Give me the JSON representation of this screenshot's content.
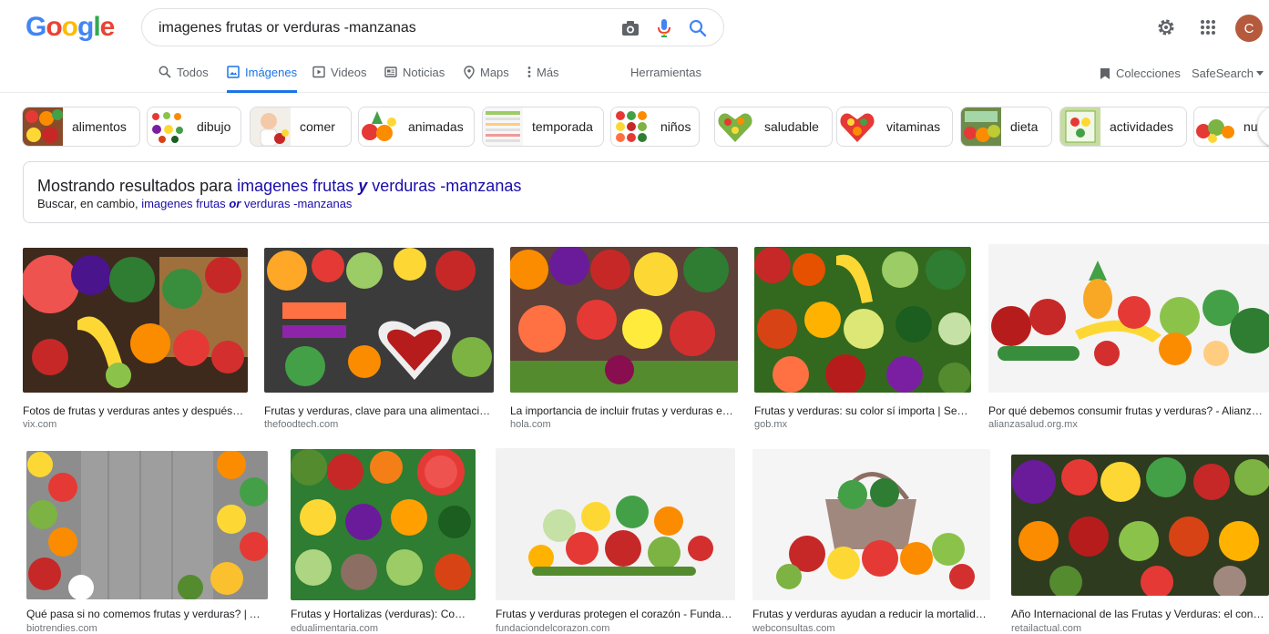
{
  "logo": {
    "g1": "G",
    "o1": "o",
    "o2": "o",
    "g2": "g",
    "l": "l",
    "e": "e"
  },
  "search": {
    "query": "imagenes frutas or verduras -manzanas"
  },
  "account": {
    "initial": "C"
  },
  "tabs": [
    {
      "label": "Todos",
      "icon": "search-icon"
    },
    {
      "label": "Imágenes",
      "icon": "image-icon"
    },
    {
      "label": "Videos",
      "icon": "video-icon"
    },
    {
      "label": "Noticias",
      "icon": "news-icon"
    },
    {
      "label": "Maps",
      "icon": "map-pin-icon"
    },
    {
      "label": "Más",
      "icon": "more-vert-icon"
    }
  ],
  "tools_label": "Herramientas",
  "collections_label": "Colecciones",
  "safesearch_label": "SafeSearch",
  "chips": [
    {
      "label": "alimentos"
    },
    {
      "label": "dibujo"
    },
    {
      "label": "comer"
    },
    {
      "label": "animadas"
    },
    {
      "label": "temporada"
    },
    {
      "label": "niños"
    },
    {
      "label": "saludable"
    },
    {
      "label": "vitaminas"
    },
    {
      "label": "dieta"
    },
    {
      "label": "actividades"
    },
    {
      "label": "nut"
    }
  ],
  "correction": {
    "showing_prefix": "Mostrando resultados para",
    "corrected_a": "imagenes frutas",
    "corrected_b": "y",
    "corrected_c": "verduras -manzanas",
    "instead_prefix": "Buscar, en cambio,",
    "original_a": "imagenes frutas",
    "original_b": "or",
    "original_c": "verduras -manzanas"
  },
  "results": [
    {
      "caption": "Fotos de frutas y verduras antes y después d...",
      "source": "vix.com"
    },
    {
      "caption": "Frutas y verduras, clave para una alimentación...",
      "source": "thefoodtech.com"
    },
    {
      "caption": "La importancia de incluir frutas y verduras en ...",
      "source": "hola.com"
    },
    {
      "caption": "Frutas y verduras: su color sí importa | Secr...",
      "source": "gob.mx"
    },
    {
      "caption": "Por qué debemos consumir frutas y verduras? - Alianza po...",
      "source": "alianzasalud.org.mx"
    },
    {
      "caption": "Qué pasa si no comemos frutas y verduras? | Aus...",
      "source": "biotrendies.com"
    },
    {
      "caption": "Frutas y Hortalizas (verduras): Compo...",
      "source": "edualimentaria.com"
    },
    {
      "caption": "Frutas y verduras protegen el corazón - Fundació...",
      "source": "fundaciondelcorazon.com"
    },
    {
      "caption": "Frutas y verduras ayudan a reducir la mortalidad...",
      "source": "webconsultas.com"
    },
    {
      "caption": "Año Internacional de las Frutas y Verduras: el consum...",
      "source": "retailactual.com"
    }
  ],
  "colors": {
    "link": "#1a0dab",
    "accent": "#1a73e8",
    "avatar": "#b55a3c"
  }
}
